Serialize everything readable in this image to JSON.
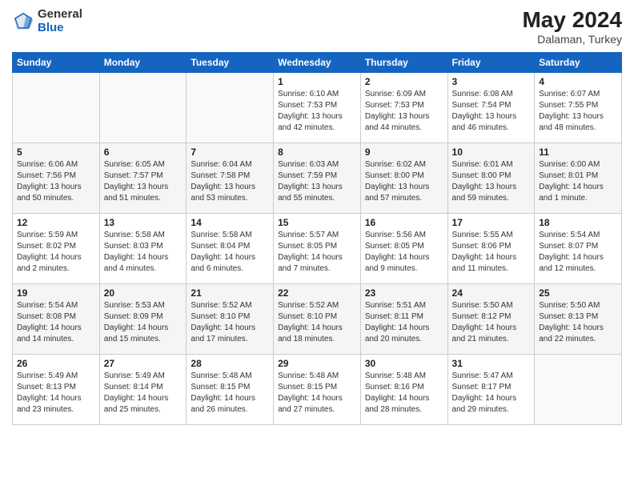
{
  "logo": {
    "general": "General",
    "blue": "Blue"
  },
  "title": {
    "month_year": "May 2024",
    "location": "Dalaman, Turkey"
  },
  "days_of_week": [
    "Sunday",
    "Monday",
    "Tuesday",
    "Wednesday",
    "Thursday",
    "Friday",
    "Saturday"
  ],
  "weeks": [
    [
      {
        "num": "",
        "info": ""
      },
      {
        "num": "",
        "info": ""
      },
      {
        "num": "",
        "info": ""
      },
      {
        "num": "1",
        "info": "Sunrise: 6:10 AM\nSunset: 7:53 PM\nDaylight: 13 hours\nand 42 minutes."
      },
      {
        "num": "2",
        "info": "Sunrise: 6:09 AM\nSunset: 7:53 PM\nDaylight: 13 hours\nand 44 minutes."
      },
      {
        "num": "3",
        "info": "Sunrise: 6:08 AM\nSunset: 7:54 PM\nDaylight: 13 hours\nand 46 minutes."
      },
      {
        "num": "4",
        "info": "Sunrise: 6:07 AM\nSunset: 7:55 PM\nDaylight: 13 hours\nand 48 minutes."
      }
    ],
    [
      {
        "num": "5",
        "info": "Sunrise: 6:06 AM\nSunset: 7:56 PM\nDaylight: 13 hours\nand 50 minutes."
      },
      {
        "num": "6",
        "info": "Sunrise: 6:05 AM\nSunset: 7:57 PM\nDaylight: 13 hours\nand 51 minutes."
      },
      {
        "num": "7",
        "info": "Sunrise: 6:04 AM\nSunset: 7:58 PM\nDaylight: 13 hours\nand 53 minutes."
      },
      {
        "num": "8",
        "info": "Sunrise: 6:03 AM\nSunset: 7:59 PM\nDaylight: 13 hours\nand 55 minutes."
      },
      {
        "num": "9",
        "info": "Sunrise: 6:02 AM\nSunset: 8:00 PM\nDaylight: 13 hours\nand 57 minutes."
      },
      {
        "num": "10",
        "info": "Sunrise: 6:01 AM\nSunset: 8:00 PM\nDaylight: 13 hours\nand 59 minutes."
      },
      {
        "num": "11",
        "info": "Sunrise: 6:00 AM\nSunset: 8:01 PM\nDaylight: 14 hours\nand 1 minute."
      }
    ],
    [
      {
        "num": "12",
        "info": "Sunrise: 5:59 AM\nSunset: 8:02 PM\nDaylight: 14 hours\nand 2 minutes."
      },
      {
        "num": "13",
        "info": "Sunrise: 5:58 AM\nSunset: 8:03 PM\nDaylight: 14 hours\nand 4 minutes."
      },
      {
        "num": "14",
        "info": "Sunrise: 5:58 AM\nSunset: 8:04 PM\nDaylight: 14 hours\nand 6 minutes."
      },
      {
        "num": "15",
        "info": "Sunrise: 5:57 AM\nSunset: 8:05 PM\nDaylight: 14 hours\nand 7 minutes."
      },
      {
        "num": "16",
        "info": "Sunrise: 5:56 AM\nSunset: 8:05 PM\nDaylight: 14 hours\nand 9 minutes."
      },
      {
        "num": "17",
        "info": "Sunrise: 5:55 AM\nSunset: 8:06 PM\nDaylight: 14 hours\nand 11 minutes."
      },
      {
        "num": "18",
        "info": "Sunrise: 5:54 AM\nSunset: 8:07 PM\nDaylight: 14 hours\nand 12 minutes."
      }
    ],
    [
      {
        "num": "19",
        "info": "Sunrise: 5:54 AM\nSunset: 8:08 PM\nDaylight: 14 hours\nand 14 minutes."
      },
      {
        "num": "20",
        "info": "Sunrise: 5:53 AM\nSunset: 8:09 PM\nDaylight: 14 hours\nand 15 minutes."
      },
      {
        "num": "21",
        "info": "Sunrise: 5:52 AM\nSunset: 8:10 PM\nDaylight: 14 hours\nand 17 minutes."
      },
      {
        "num": "22",
        "info": "Sunrise: 5:52 AM\nSunset: 8:10 PM\nDaylight: 14 hours\nand 18 minutes."
      },
      {
        "num": "23",
        "info": "Sunrise: 5:51 AM\nSunset: 8:11 PM\nDaylight: 14 hours\nand 20 minutes."
      },
      {
        "num": "24",
        "info": "Sunrise: 5:50 AM\nSunset: 8:12 PM\nDaylight: 14 hours\nand 21 minutes."
      },
      {
        "num": "25",
        "info": "Sunrise: 5:50 AM\nSunset: 8:13 PM\nDaylight: 14 hours\nand 22 minutes."
      }
    ],
    [
      {
        "num": "26",
        "info": "Sunrise: 5:49 AM\nSunset: 8:13 PM\nDaylight: 14 hours\nand 23 minutes."
      },
      {
        "num": "27",
        "info": "Sunrise: 5:49 AM\nSunset: 8:14 PM\nDaylight: 14 hours\nand 25 minutes."
      },
      {
        "num": "28",
        "info": "Sunrise: 5:48 AM\nSunset: 8:15 PM\nDaylight: 14 hours\nand 26 minutes."
      },
      {
        "num": "29",
        "info": "Sunrise: 5:48 AM\nSunset: 8:15 PM\nDaylight: 14 hours\nand 27 minutes."
      },
      {
        "num": "30",
        "info": "Sunrise: 5:48 AM\nSunset: 8:16 PM\nDaylight: 14 hours\nand 28 minutes."
      },
      {
        "num": "31",
        "info": "Sunrise: 5:47 AM\nSunset: 8:17 PM\nDaylight: 14 hours\nand 29 minutes."
      },
      {
        "num": "",
        "info": ""
      }
    ]
  ]
}
